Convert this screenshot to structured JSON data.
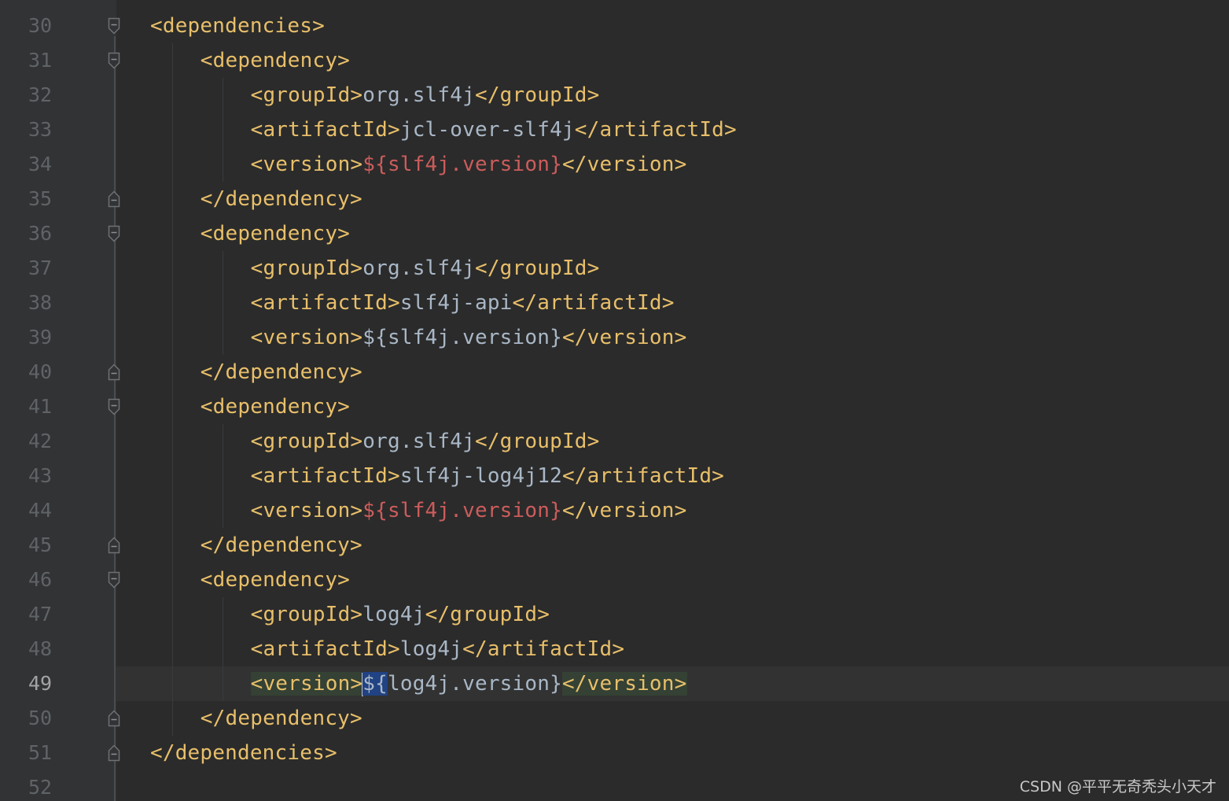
{
  "editor": {
    "language": "xml",
    "current_line": 49,
    "watermark": "CSDN @平平无奇秃头小天才"
  },
  "lines": [
    {
      "num": "30",
      "fold": "open",
      "indent": 2,
      "tokens": [
        {
          "t": "tag",
          "v": "<dependencies>"
        }
      ]
    },
    {
      "num": "31",
      "fold": "open",
      "indent": 4,
      "tokens": [
        {
          "t": "tag",
          "v": "<dependency>"
        }
      ]
    },
    {
      "num": "32",
      "fold": "",
      "indent": 6,
      "tokens": [
        {
          "t": "tag",
          "v": "<groupId>"
        },
        {
          "t": "txt",
          "v": "org.slf4j"
        },
        {
          "t": "tag",
          "v": "</groupId>"
        }
      ]
    },
    {
      "num": "33",
      "fold": "",
      "indent": 6,
      "tokens": [
        {
          "t": "tag",
          "v": "<artifactId>"
        },
        {
          "t": "txt",
          "v": "jcl-over-slf4j"
        },
        {
          "t": "tag",
          "v": "</artifactId>"
        }
      ]
    },
    {
      "num": "34",
      "fold": "",
      "indent": 6,
      "tokens": [
        {
          "t": "tag",
          "v": "<version>"
        },
        {
          "t": "red",
          "v": "${slf4j.version}"
        },
        {
          "t": "tag",
          "v": "</version>"
        }
      ]
    },
    {
      "num": "35",
      "fold": "close",
      "indent": 4,
      "tokens": [
        {
          "t": "tag",
          "v": "</dependency>"
        }
      ]
    },
    {
      "num": "36",
      "fold": "open",
      "indent": 4,
      "tokens": [
        {
          "t": "tag",
          "v": "<dependency>"
        }
      ]
    },
    {
      "num": "37",
      "fold": "",
      "indent": 6,
      "tokens": [
        {
          "t": "tag",
          "v": "<groupId>"
        },
        {
          "t": "txt",
          "v": "org.slf4j"
        },
        {
          "t": "tag",
          "v": "</groupId>"
        }
      ]
    },
    {
      "num": "38",
      "fold": "",
      "indent": 6,
      "tokens": [
        {
          "t": "tag",
          "v": "<artifactId>"
        },
        {
          "t": "txt",
          "v": "slf4j-api"
        },
        {
          "t": "tag",
          "v": "</artifactId>"
        }
      ]
    },
    {
      "num": "39",
      "fold": "",
      "indent": 6,
      "tokens": [
        {
          "t": "tag",
          "v": "<version>"
        },
        {
          "t": "txt",
          "v": "${slf4j.version}"
        },
        {
          "t": "tag",
          "v": "</version>"
        }
      ]
    },
    {
      "num": "40",
      "fold": "close",
      "indent": 4,
      "tokens": [
        {
          "t": "tag",
          "v": "</dependency>"
        }
      ]
    },
    {
      "num": "41",
      "fold": "open",
      "indent": 4,
      "tokens": [
        {
          "t": "tag",
          "v": "<dependency>"
        }
      ]
    },
    {
      "num": "42",
      "fold": "",
      "indent": 6,
      "tokens": [
        {
          "t": "tag",
          "v": "<groupId>"
        },
        {
          "t": "txt",
          "v": "org.slf4j"
        },
        {
          "t": "tag",
          "v": "</groupId>"
        }
      ]
    },
    {
      "num": "43",
      "fold": "",
      "indent": 6,
      "tokens": [
        {
          "t": "tag",
          "v": "<artifactId>"
        },
        {
          "t": "txt",
          "v": "slf4j-log4j12"
        },
        {
          "t": "tag",
          "v": "</artifactId>"
        }
      ]
    },
    {
      "num": "44",
      "fold": "",
      "indent": 6,
      "tokens": [
        {
          "t": "tag",
          "v": "<version>"
        },
        {
          "t": "red",
          "v": "${slf4j.version}"
        },
        {
          "t": "tag",
          "v": "</version>"
        }
      ]
    },
    {
      "num": "45",
      "fold": "close",
      "indent": 4,
      "tokens": [
        {
          "t": "tag",
          "v": "</dependency>"
        }
      ]
    },
    {
      "num": "46",
      "fold": "open",
      "indent": 4,
      "tokens": [
        {
          "t": "tag",
          "v": "<dependency>"
        }
      ]
    },
    {
      "num": "47",
      "fold": "",
      "indent": 6,
      "tokens": [
        {
          "t": "tag",
          "v": "<groupId>"
        },
        {
          "t": "txt",
          "v": "log4j"
        },
        {
          "t": "tag",
          "v": "</groupId>"
        }
      ]
    },
    {
      "num": "48",
      "fold": "",
      "indent": 6,
      "tokens": [
        {
          "t": "tag",
          "v": "<artifactId>"
        },
        {
          "t": "txt",
          "v": "log4j"
        },
        {
          "t": "tag",
          "v": "</artifactId>"
        }
      ]
    },
    {
      "num": "49",
      "fold": "",
      "indent": 6,
      "tokens": [
        {
          "t": "tag-hl",
          "v": "<version>"
        },
        {
          "t": "caret",
          "v": ""
        },
        {
          "t": "txt-caret",
          "v": "${"
        },
        {
          "t": "txt",
          "v": "log4j.version}"
        },
        {
          "t": "tag-hl",
          "v": "</version>"
        }
      ]
    },
    {
      "num": "50",
      "fold": "close",
      "indent": 4,
      "tokens": [
        {
          "t": "tag",
          "v": "</dependency>"
        }
      ]
    },
    {
      "num": "51",
      "fold": "close",
      "indent": 2,
      "tokens": [
        {
          "t": "tag",
          "v": "</dependencies>"
        }
      ]
    },
    {
      "num": "52",
      "fold": "",
      "indent": 0,
      "tokens": []
    }
  ],
  "colors": {
    "background": "#2b2b2b",
    "gutter": "#313335",
    "tag": "#e8bf6a",
    "text": "#a9b7c6",
    "unresolved_property": "#cc5c5c",
    "line_number": "#606366",
    "tag_match_highlight": "#344134",
    "caret_brace_highlight": "#214283"
  }
}
